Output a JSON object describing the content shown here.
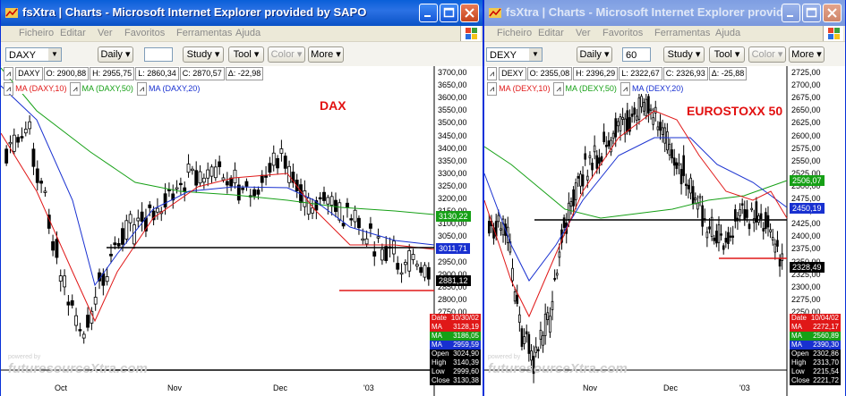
{
  "left": {
    "title": "fsXtra | Charts - Microsoft Internet Explorer provided by SAPO",
    "menu": [
      "Ficheiro",
      "Editar",
      "Ver",
      "Favoritos",
      "Ferramentas",
      "Ajuda"
    ],
    "symbol": "DAXY",
    "interval_value": "",
    "buttons": {
      "period": "Daily",
      "study": "Study",
      "tool": "Tool",
      "color": "Color",
      "more": "More"
    },
    "quote": {
      "symbol": "DAXY",
      "open": "O: 2900,88",
      "high": "H: 2955,75",
      "low": "L: 2860,34",
      "close": "C: 2870,57",
      "change": "Δ: -22,98"
    },
    "legend": [
      "MA (DAXY,10)",
      "MA (DAXY,50)",
      "MA (DAXY,20)"
    ],
    "chart_title": "DAX",
    "y_ticks": [
      "3700,00",
      "3650,00",
      "3600,00",
      "3550,00",
      "3500,00",
      "3450,00",
      "3400,00",
      "3350,00",
      "3300,00",
      "3250,00",
      "3200,00",
      "3150,00",
      "3100,00",
      "3050,00",
      "3000,00",
      "2950,00",
      "2900,00",
      "2850,00",
      "2800,00",
      "2750,00"
    ],
    "x_ticks": [
      "Oct",
      "Nov",
      "Dec",
      "'03"
    ],
    "value_boxes": {
      "ma50": "3130,22",
      "ma20": "3011,71",
      "last": "2881,12"
    },
    "data_table": [
      {
        "label": "Date",
        "value": "10/30/02"
      },
      {
        "label": "MA",
        "value": "3128,19"
      },
      {
        "label": "MA",
        "value": "3186,05"
      },
      {
        "label": "MA",
        "value": "2959,59"
      },
      {
        "label": "Open",
        "value": "3024,90"
      },
      {
        "label": "High",
        "value": "3140,39"
      },
      {
        "label": "Low",
        "value": "2999,60"
      },
      {
        "label": "Close",
        "value": "3130,38"
      }
    ],
    "watermark": {
      "small": "powered by",
      "big": "futuresourceXtra.com"
    }
  },
  "right": {
    "title": "fsXtra | Charts - Microsoft Internet Explorer provide...",
    "menu": [
      "Ficheiro",
      "Editar",
      "Ver",
      "Favoritos",
      "Ferramentas",
      "Ajuda"
    ],
    "symbol": "DEXY",
    "interval_value": "60",
    "buttons": {
      "period": "Daily",
      "study": "Study",
      "tool": "Tool",
      "color": "Color",
      "more": "More"
    },
    "quote": {
      "symbol": "DEXY",
      "open": "O: 2355,08",
      "high": "H: 2396,29",
      "low": "L: 2322,67",
      "close": "C: 2326,93",
      "change": "Δ: -25,88"
    },
    "legend": [
      "MA (DEXY,10)",
      "MA (DEXY,50)",
      "MA (DEXY,20)"
    ],
    "chart_title": "EUROSTOXX 50",
    "y_ticks": [
      "2725,00",
      "2700,00",
      "2675,00",
      "2650,00",
      "2625,00",
      "2600,00",
      "2575,00",
      "2550,00",
      "2525,00",
      "2500,00",
      "2475,00",
      "2450,00",
      "2425,00",
      "2400,00",
      "2375,00",
      "2350,00",
      "2325,00",
      "2300,00",
      "2275,00",
      "2250,00",
      "2225,00",
      "2200,00"
    ],
    "x_ticks": [
      "Nov",
      "Dec",
      "'03"
    ],
    "value_boxes": {
      "ma50": "2506,07",
      "ma20": "2450,19",
      "last": "2328,49"
    },
    "data_table": [
      {
        "label": "Date",
        "value": "10/04/02"
      },
      {
        "label": "MA",
        "value": "2272,17"
      },
      {
        "label": "MA",
        "value": "2560,89"
      },
      {
        "label": "MA",
        "value": "2390,30"
      },
      {
        "label": "Open",
        "value": "2302,86"
      },
      {
        "label": "High",
        "value": "2313,70"
      },
      {
        "label": "Low",
        "value": "2215,54"
      },
      {
        "label": "Close",
        "value": "2221,72"
      }
    ],
    "watermark": {
      "small": "powered by",
      "big": "futuresourceXtra.com"
    }
  },
  "colors": {
    "ma10": "#e01818",
    "ma50": "#16a016",
    "ma20": "#1830d0",
    "candle": "#000000",
    "support": "#e01818",
    "title_active": "#0a5fd8"
  }
}
